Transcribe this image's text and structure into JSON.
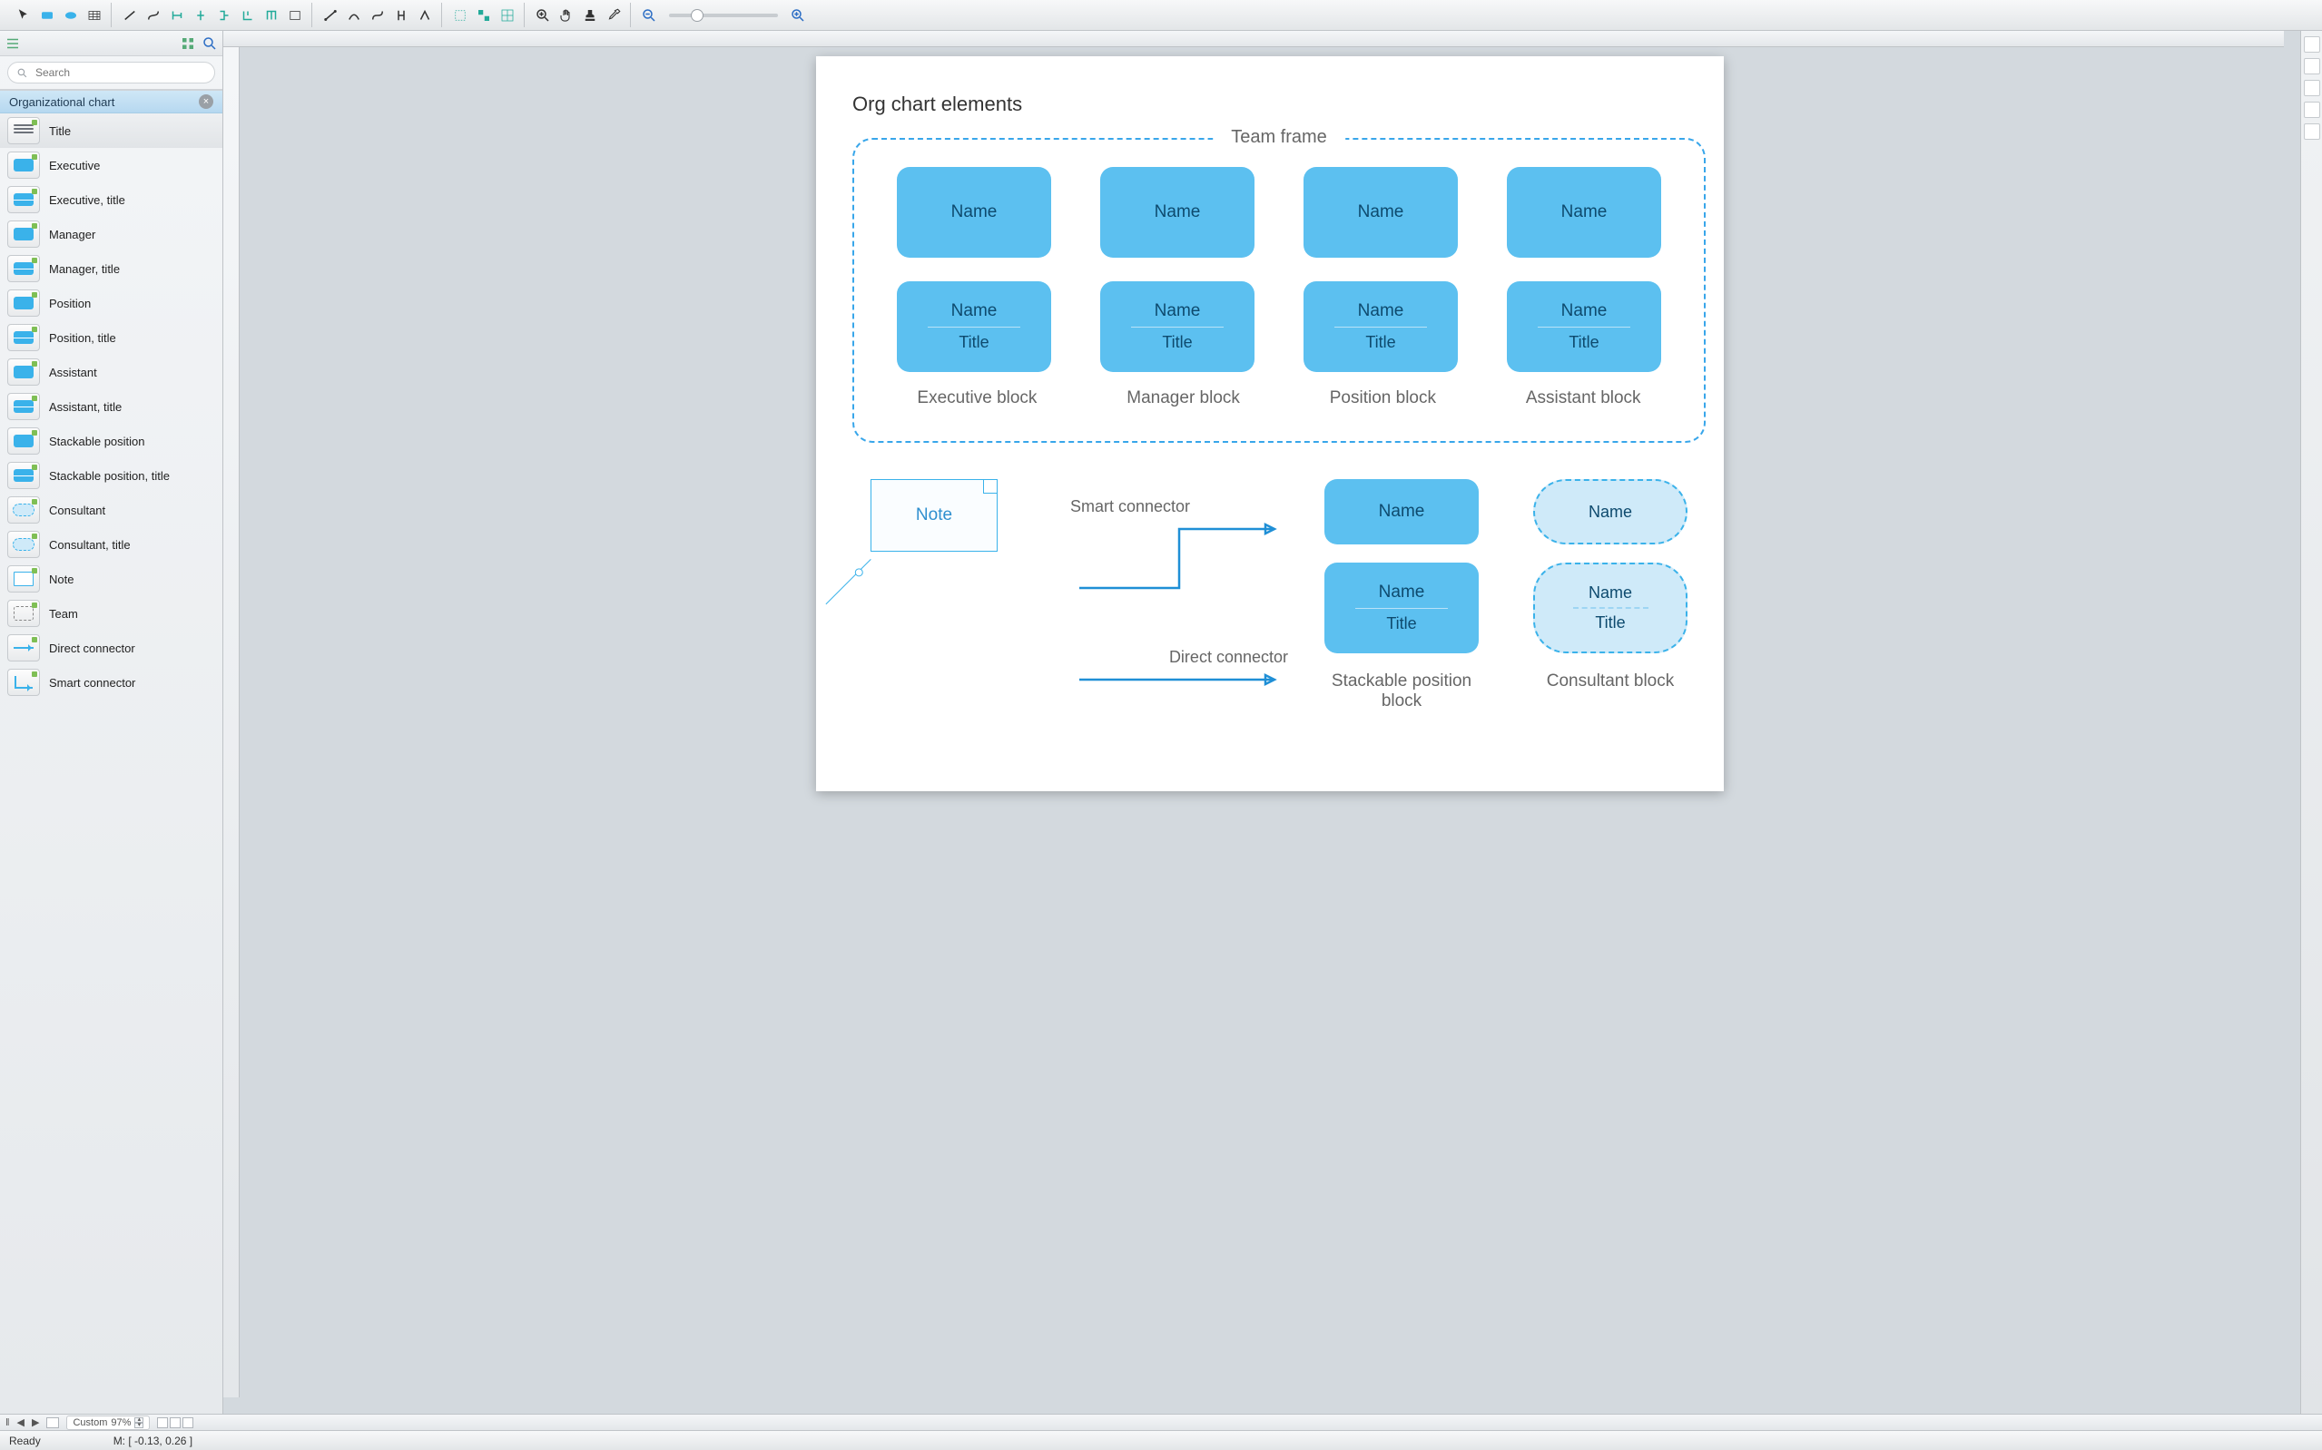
{
  "search": {
    "placeholder": "Search"
  },
  "section_header": "Organizational chart",
  "sidebar_items": [
    {
      "label": "Title",
      "thumb": "lines",
      "selected": true
    },
    {
      "label": "Executive",
      "thumb": "block",
      "selected": false
    },
    {
      "label": "Executive, title",
      "thumb": "split",
      "selected": false
    },
    {
      "label": "Manager",
      "thumb": "block",
      "selected": false
    },
    {
      "label": "Manager, title",
      "thumb": "split",
      "selected": false
    },
    {
      "label": "Position",
      "thumb": "block",
      "selected": false
    },
    {
      "label": "Position, title",
      "thumb": "split",
      "selected": false
    },
    {
      "label": "Assistant",
      "thumb": "block",
      "selected": false
    },
    {
      "label": "Assistant, title",
      "thumb": "split",
      "selected": false
    },
    {
      "label": "Stackable position",
      "thumb": "block",
      "selected": false
    },
    {
      "label": "Stackable position, title",
      "thumb": "split",
      "selected": false
    },
    {
      "label": "Consultant",
      "thumb": "ellipse",
      "selected": false
    },
    {
      "label": "Consultant, title",
      "thumb": "ellipse",
      "selected": false
    },
    {
      "label": "Note",
      "thumb": "note",
      "selected": false
    },
    {
      "label": "Team",
      "thumb": "team",
      "selected": false
    },
    {
      "label": "Direct connector",
      "thumb": "arrow",
      "selected": false
    },
    {
      "label": "Smart connector",
      "thumb": "smart",
      "selected": false
    }
  ],
  "canvas": {
    "title": "Org chart elements",
    "team_frame_label": "Team frame",
    "name_text": "Name",
    "title_text": "Title",
    "column_labels": [
      "Executive block",
      "Manager block",
      "Position block",
      "Assistant block"
    ],
    "note_label": "Note",
    "smart_connector_label": "Smart connector",
    "direct_connector_label": "Direct connector",
    "stackable_label": "Stackable position block",
    "consultant_label": "Consultant block"
  },
  "statusbar": {
    "ready": "Ready",
    "zoom_prefix": "Custom",
    "zoom_value": "97%",
    "mouse_label": "M:",
    "mouse_coords": "[ -0.13, 0.26 ]"
  },
  "colors": {
    "accent": "#3ab2ea",
    "block": "#5cc0f0",
    "text": "#0e4a6e"
  }
}
